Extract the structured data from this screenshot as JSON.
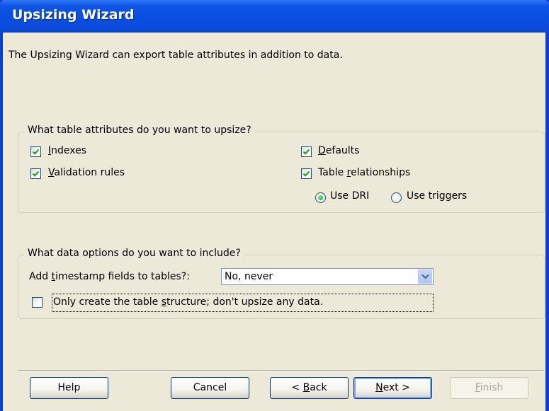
{
  "window": {
    "title": "Upsizing Wizard"
  },
  "intro": "The Upsizing Wizard can export table attributes in addition to data.",
  "attributes_group": {
    "caption": "What table attributes do you want to upsize?",
    "indexes": {
      "label_key": "I",
      "label_rest": "ndexes",
      "checked": true
    },
    "validation": {
      "label_key": "V",
      "label_rest": "alidation rules",
      "checked": true
    },
    "defaults": {
      "label_key": "D",
      "label_rest": "efaults",
      "checked": true
    },
    "relationships": {
      "label_pre": "Table ",
      "label_key": "r",
      "label_rest": "elationships",
      "checked": true
    },
    "use_dri": {
      "label": "Use DRI",
      "selected": true
    },
    "use_triggers": {
      "label": "Use triggers",
      "selected": false
    }
  },
  "data_group": {
    "caption": "What data options do you want to include?",
    "timestamp_label_pre": "Add ",
    "timestamp_label_key": "t",
    "timestamp_label_rest": "imestamp fields to tables?:",
    "timestamp_value": "No, never",
    "structure_only_pre": "Only create the table ",
    "structure_only_key": "s",
    "structure_only_rest": "tructure; don't upsize any data.",
    "structure_only_checked": false
  },
  "buttons": {
    "help": "Help",
    "cancel": "Cancel",
    "back_pre": "< ",
    "back_key": "B",
    "back_rest": "ack",
    "next_key": "N",
    "next_rest": "ext >",
    "finish_key": "F",
    "finish_rest": "inish"
  },
  "colors": {
    "titlebar": "#0a4fe0",
    "client": "#ece9d8",
    "check": "#21a121"
  }
}
